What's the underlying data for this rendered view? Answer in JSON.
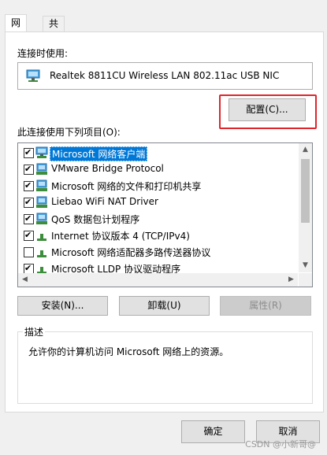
{
  "tabs": [
    {
      "label": "网络"
    },
    {
      "label": "共享"
    }
  ],
  "connect_using_label": "连接时使用:",
  "adapter_name": "Realtek 8811CU Wireless LAN 802.11ac USB NIC",
  "configure_button": "配置(C)...",
  "items_label": "此连接使用下列项目(O):",
  "items": [
    {
      "label": "Microsoft 网络客户端",
      "checked": true,
      "selected": true,
      "icon": "network-client-icon"
    },
    {
      "label": "VMware Bridge Protocol",
      "checked": true,
      "selected": false,
      "icon": "network-service-icon"
    },
    {
      "label": "Microsoft 网络的文件和打印机共享",
      "checked": true,
      "selected": false,
      "icon": "network-service-icon"
    },
    {
      "label": "Liebao WiFi NAT Driver",
      "checked": true,
      "selected": false,
      "icon": "network-service-icon"
    },
    {
      "label": "QoS 数据包计划程序",
      "checked": true,
      "selected": false,
      "icon": "network-service-icon"
    },
    {
      "label": "Internet 协议版本 4 (TCP/IPv4)",
      "checked": true,
      "selected": false,
      "icon": "protocol-icon"
    },
    {
      "label": "Microsoft 网络适配器多路传送器协议",
      "checked": false,
      "selected": false,
      "icon": "protocol-icon"
    },
    {
      "label": "Microsoft LLDP 协议驱动程序",
      "checked": true,
      "selected": false,
      "icon": "protocol-icon"
    }
  ],
  "install_button": "安装(N)...",
  "uninstall_button": "卸载(U)",
  "properties_button": "属性(R)",
  "description_label": "描述",
  "description_text": "允许你的计算机访问 Microsoft 网络上的资源。",
  "ok_button": "确定",
  "cancel_button": "取消",
  "watermark": "CSDN @小新哥@",
  "colors": {
    "accent": "#0078d7",
    "highlight_border": "#e0242b"
  }
}
